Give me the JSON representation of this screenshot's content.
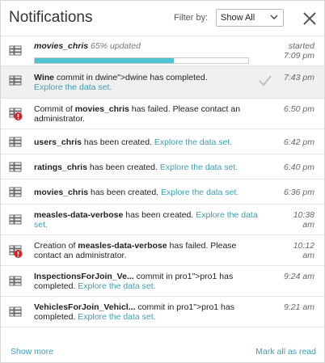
{
  "header": {
    "title": "Notifications",
    "filter_label": "Filter by:",
    "filter_value": "Show All"
  },
  "items": [
    {
      "kind": "progress",
      "name": "movies_chris",
      "pct_text": "65% updated",
      "progress": 0.65,
      "time_line1": "started",
      "time_line2": "7:09 pm"
    },
    {
      "kind": "done",
      "bold": "Wine",
      "text": " commit in dwine\">dwine has completed.",
      "link": "Explore the data set.",
      "time": "7:43 pm"
    },
    {
      "kind": "error",
      "prefix": "Commit of ",
      "bold": "movies_chris",
      "text": " has failed. Please contact an administrator.",
      "time": "6:50 pm"
    },
    {
      "kind": "created",
      "bold": "users_chris",
      "text": " has been created.",
      "link": "Explore the data set.",
      "time": "6:42 pm"
    },
    {
      "kind": "created",
      "bold": "ratings_chris",
      "text": " has been created.",
      "link": "Explore the data set.",
      "time": "6:40 pm"
    },
    {
      "kind": "created",
      "bold": "movies_chris",
      "text": " has been created.",
      "link": "Explore the data set.",
      "time": "6:36 pm"
    },
    {
      "kind": "created",
      "bold": "measles-data-verbose",
      "text": " has been created.",
      "link": "Explore the data set.",
      "time_line1": "10:38",
      "time_line2": "am"
    },
    {
      "kind": "error",
      "prefix": "Creation of ",
      "bold": "measles-data-verbose",
      "text": " has failed. Please contact an administrator.",
      "time_line1": "10:12",
      "time_line2": "am"
    },
    {
      "kind": "created",
      "bold": "InspectionsForJoin_Ve...",
      "text": " commit in pro1\">pro1 has completed.",
      "link": "Explore the data set.",
      "time": "9:24 am"
    },
    {
      "kind": "created",
      "bold": "VehiclesForJoin_Vehicl...",
      "text": " commit in pro1\">pro1 has completed.",
      "link": "Explore the data set.",
      "time": "9:21 am"
    }
  ],
  "footer": {
    "show_more": "Show more",
    "mark_all": "Mark all as read"
  },
  "colors": {
    "accent_link": "#3a9fb5",
    "progress_fill": "#4ec3cf",
    "error_badge": "#d9232b",
    "highlight_row": "#f0f0f0"
  },
  "icons": {
    "dataset": "dataset-grid-icon",
    "error": "error-badge-icon",
    "check": "check-icon",
    "close": "close-icon",
    "chevron": "chevron-down-icon"
  }
}
